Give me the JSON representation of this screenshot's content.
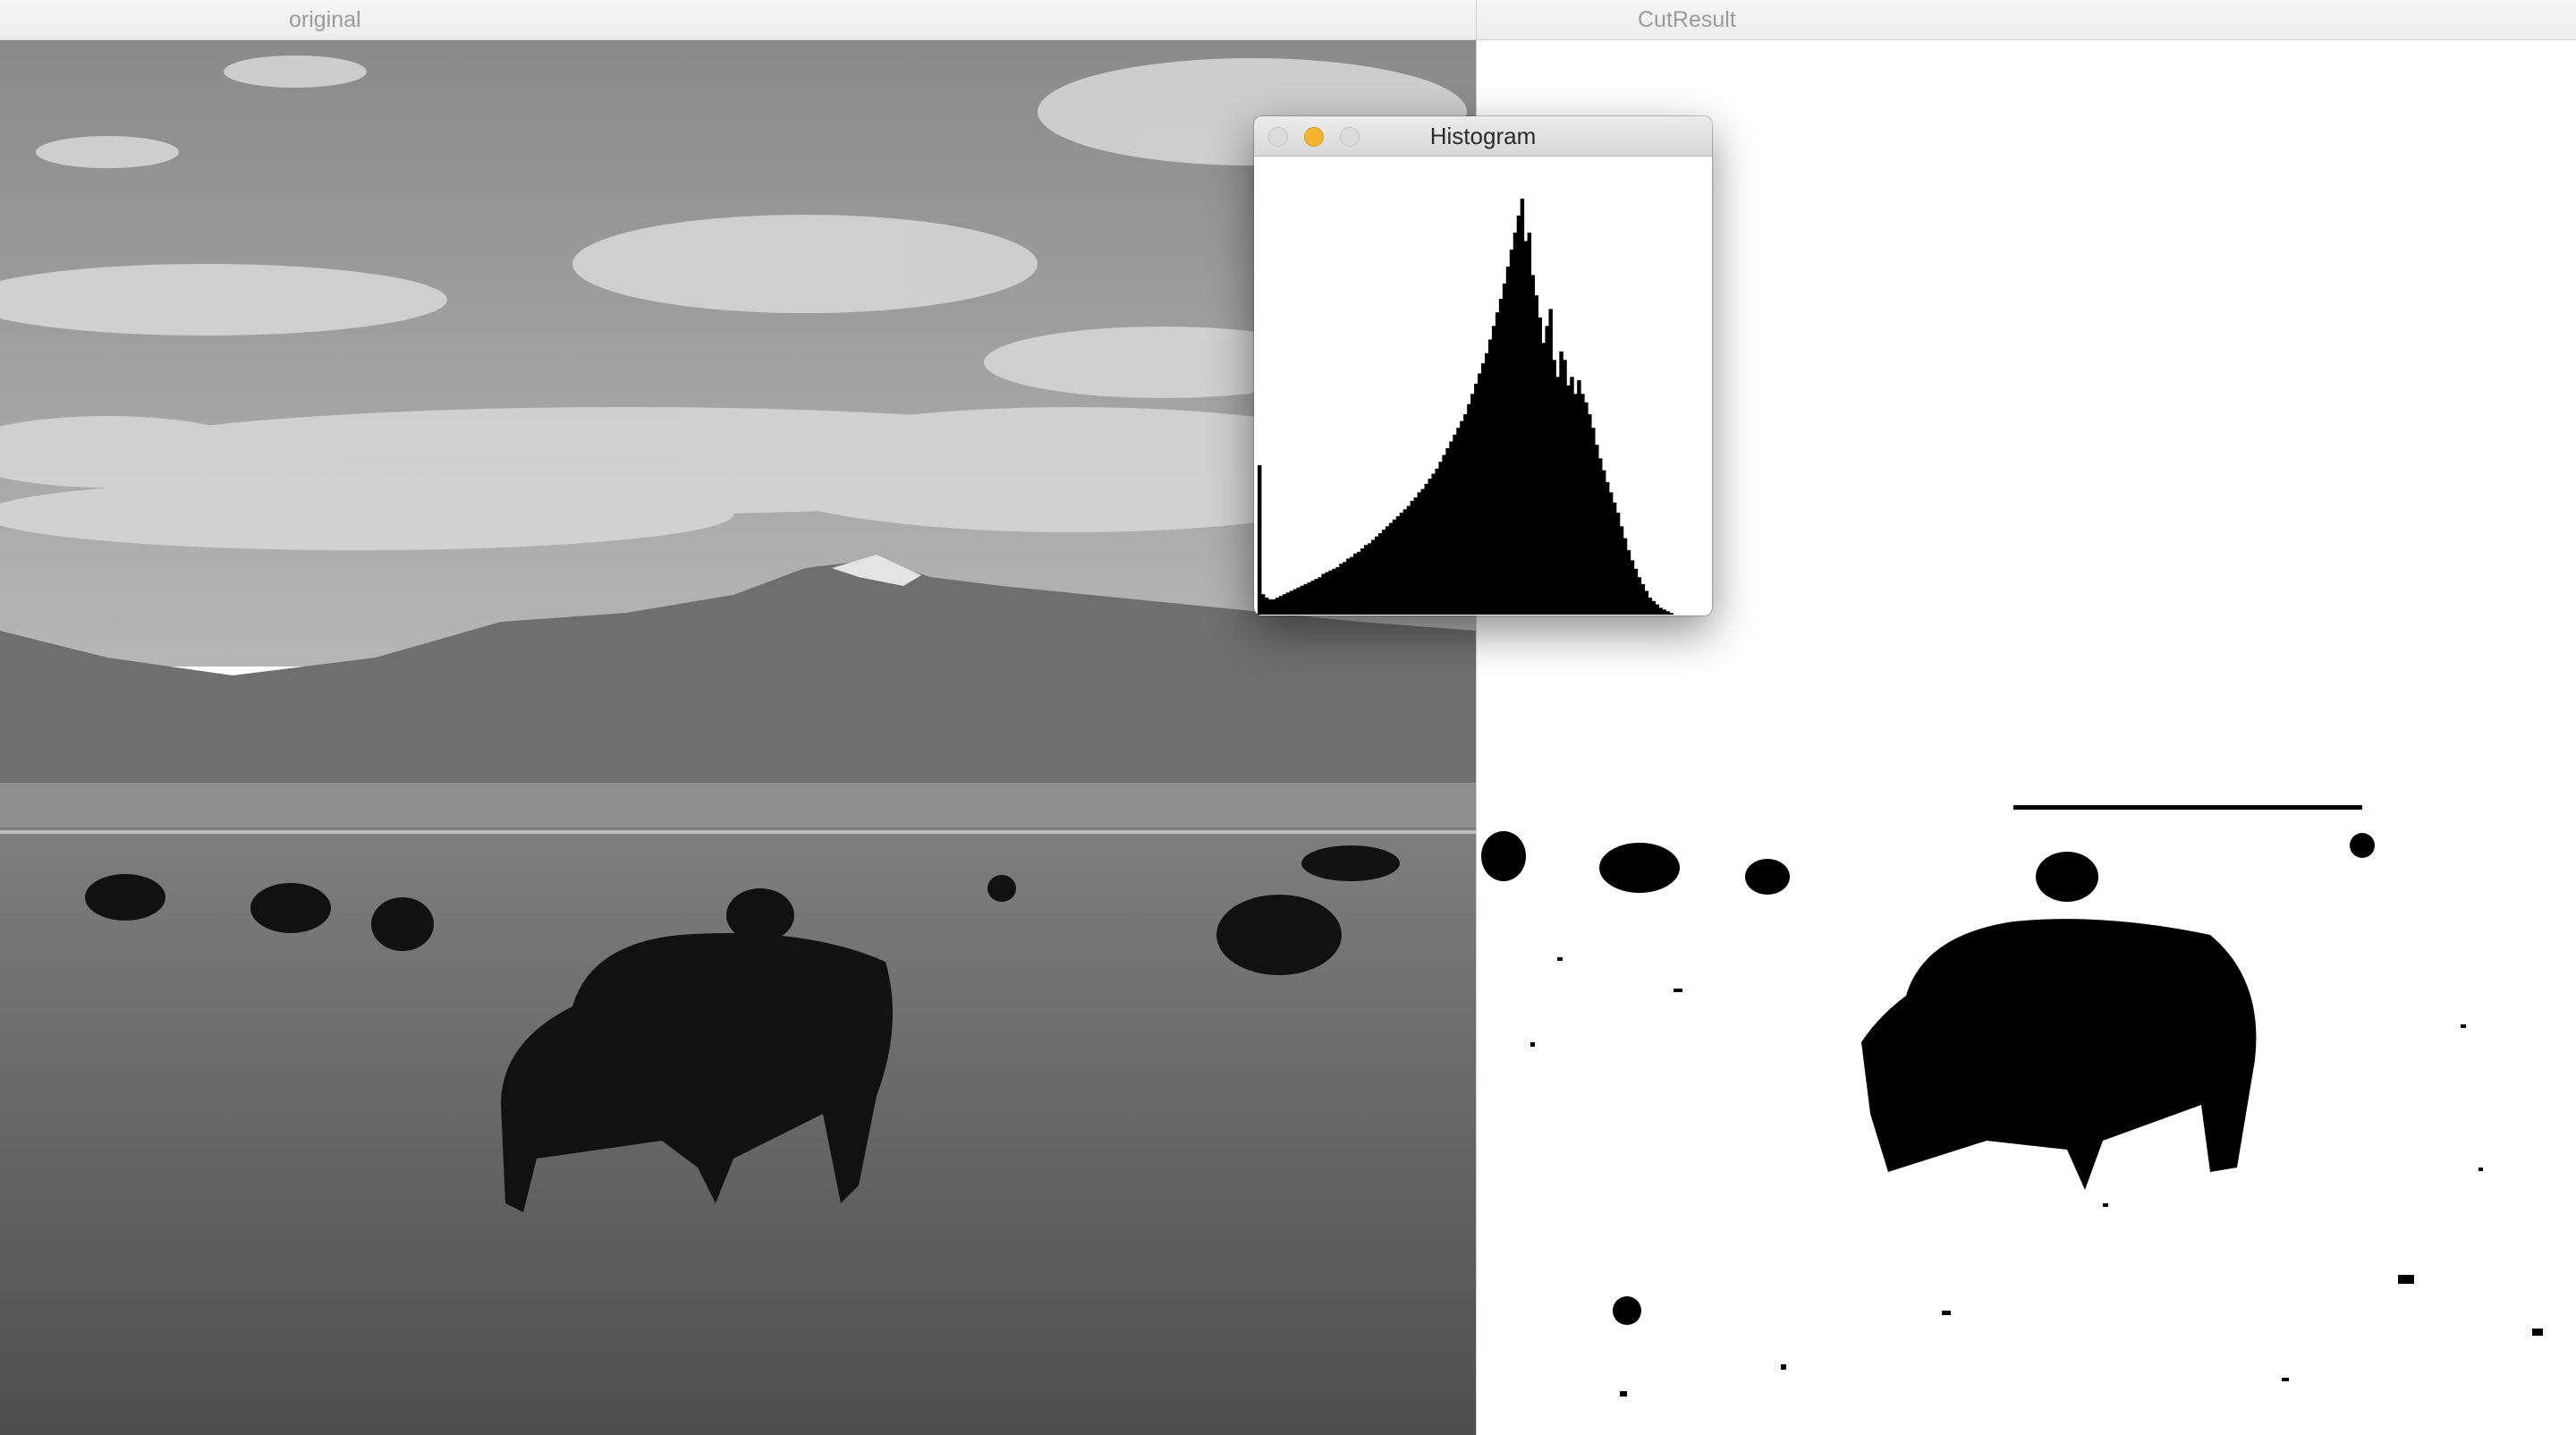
{
  "windows": {
    "original": {
      "title": "original"
    },
    "cut_result": {
      "title": "CutResult"
    },
    "histogram": {
      "title": "Histogram",
      "controls": [
        "close-icon",
        "minimize-icon",
        "zoom-icon"
      ],
      "bins": [
        0,
        88,
        12,
        10,
        9,
        9,
        10,
        11,
        12,
        13,
        14,
        15,
        16,
        17,
        18,
        19,
        20,
        21,
        22,
        24,
        25,
        26,
        27,
        28,
        30,
        31,
        33,
        34,
        36,
        37,
        39,
        41,
        42,
        44,
        46,
        48,
        50,
        52,
        54,
        56,
        58,
        60,
        62,
        64,
        67,
        69,
        72,
        74,
        77,
        80,
        83,
        86,
        90,
        94,
        98,
        102,
        106,
        110,
        114,
        118,
        124,
        130,
        136,
        142,
        148,
        154,
        162,
        170,
        178,
        186,
        195,
        205,
        215,
        225,
        235,
        245,
        220,
        225,
        200,
        188,
        175,
        160,
        170,
        180,
        150,
        140,
        155,
        150,
        135,
        140,
        130,
        138,
        130,
        125,
        118,
        110,
        100,
        92,
        85,
        78,
        72,
        66,
        60,
        52,
        45,
        38,
        32,
        27,
        22,
        18,
        14,
        10,
        8,
        6,
        4,
        3,
        2,
        1,
        0,
        0,
        0,
        0,
        0,
        0,
        0,
        0,
        0,
        0,
        0
      ]
    }
  },
  "colors": {
    "sky": "#a8a8a8",
    "ground": "#5e5e5e",
    "silhouette": "#000000"
  }
}
